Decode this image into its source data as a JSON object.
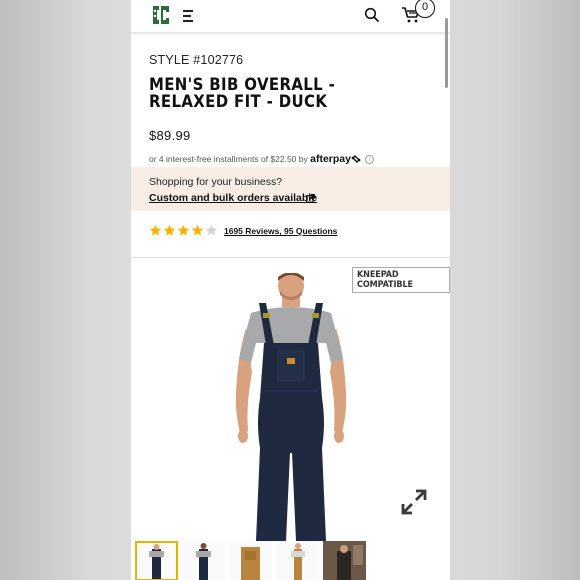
{
  "header": {
    "logo_icon": "carhartt-c-logo-icon",
    "menu_icon": "hamburger-menu-icon",
    "search_icon": "search-icon",
    "cart_icon": "cart-icon",
    "cart_count": "0"
  },
  "product": {
    "style": "STYLE #102776",
    "title": "MEN'S BIB OVERALL - RELAXED FIT - DUCK",
    "price": "$89.99",
    "afterpay": {
      "text": "or 4 interest-free installments of $22.50 by",
      "brand": "afterpay",
      "info_icon": "info-icon"
    },
    "business": {
      "prompt": "Shopping for your business?",
      "link": "Custom and bulk orders available",
      "link_icon": "external-link-icon"
    },
    "rating": {
      "stars": 4,
      "max": 5,
      "reviews_label": "1695 Reviews, 95 Questions"
    },
    "badge": "KNEEPAD COMPATIBLE",
    "expand_icon": "expand-icon",
    "thumbnails": [
      {
        "name": "front-view",
        "selected": true
      },
      {
        "name": "back-view",
        "selected": false
      },
      {
        "name": "brown-bib-view",
        "selected": false
      },
      {
        "name": "brown-full-view",
        "selected": false
      },
      {
        "name": "lifestyle-view",
        "selected": false
      }
    ]
  },
  "colors": {
    "star_filled": "#f3b300",
    "star_empty": "#d3d3d3",
    "business_bg": "#f7ede4",
    "navy": "#1f2940",
    "logo_green": "#2e6b3b"
  }
}
